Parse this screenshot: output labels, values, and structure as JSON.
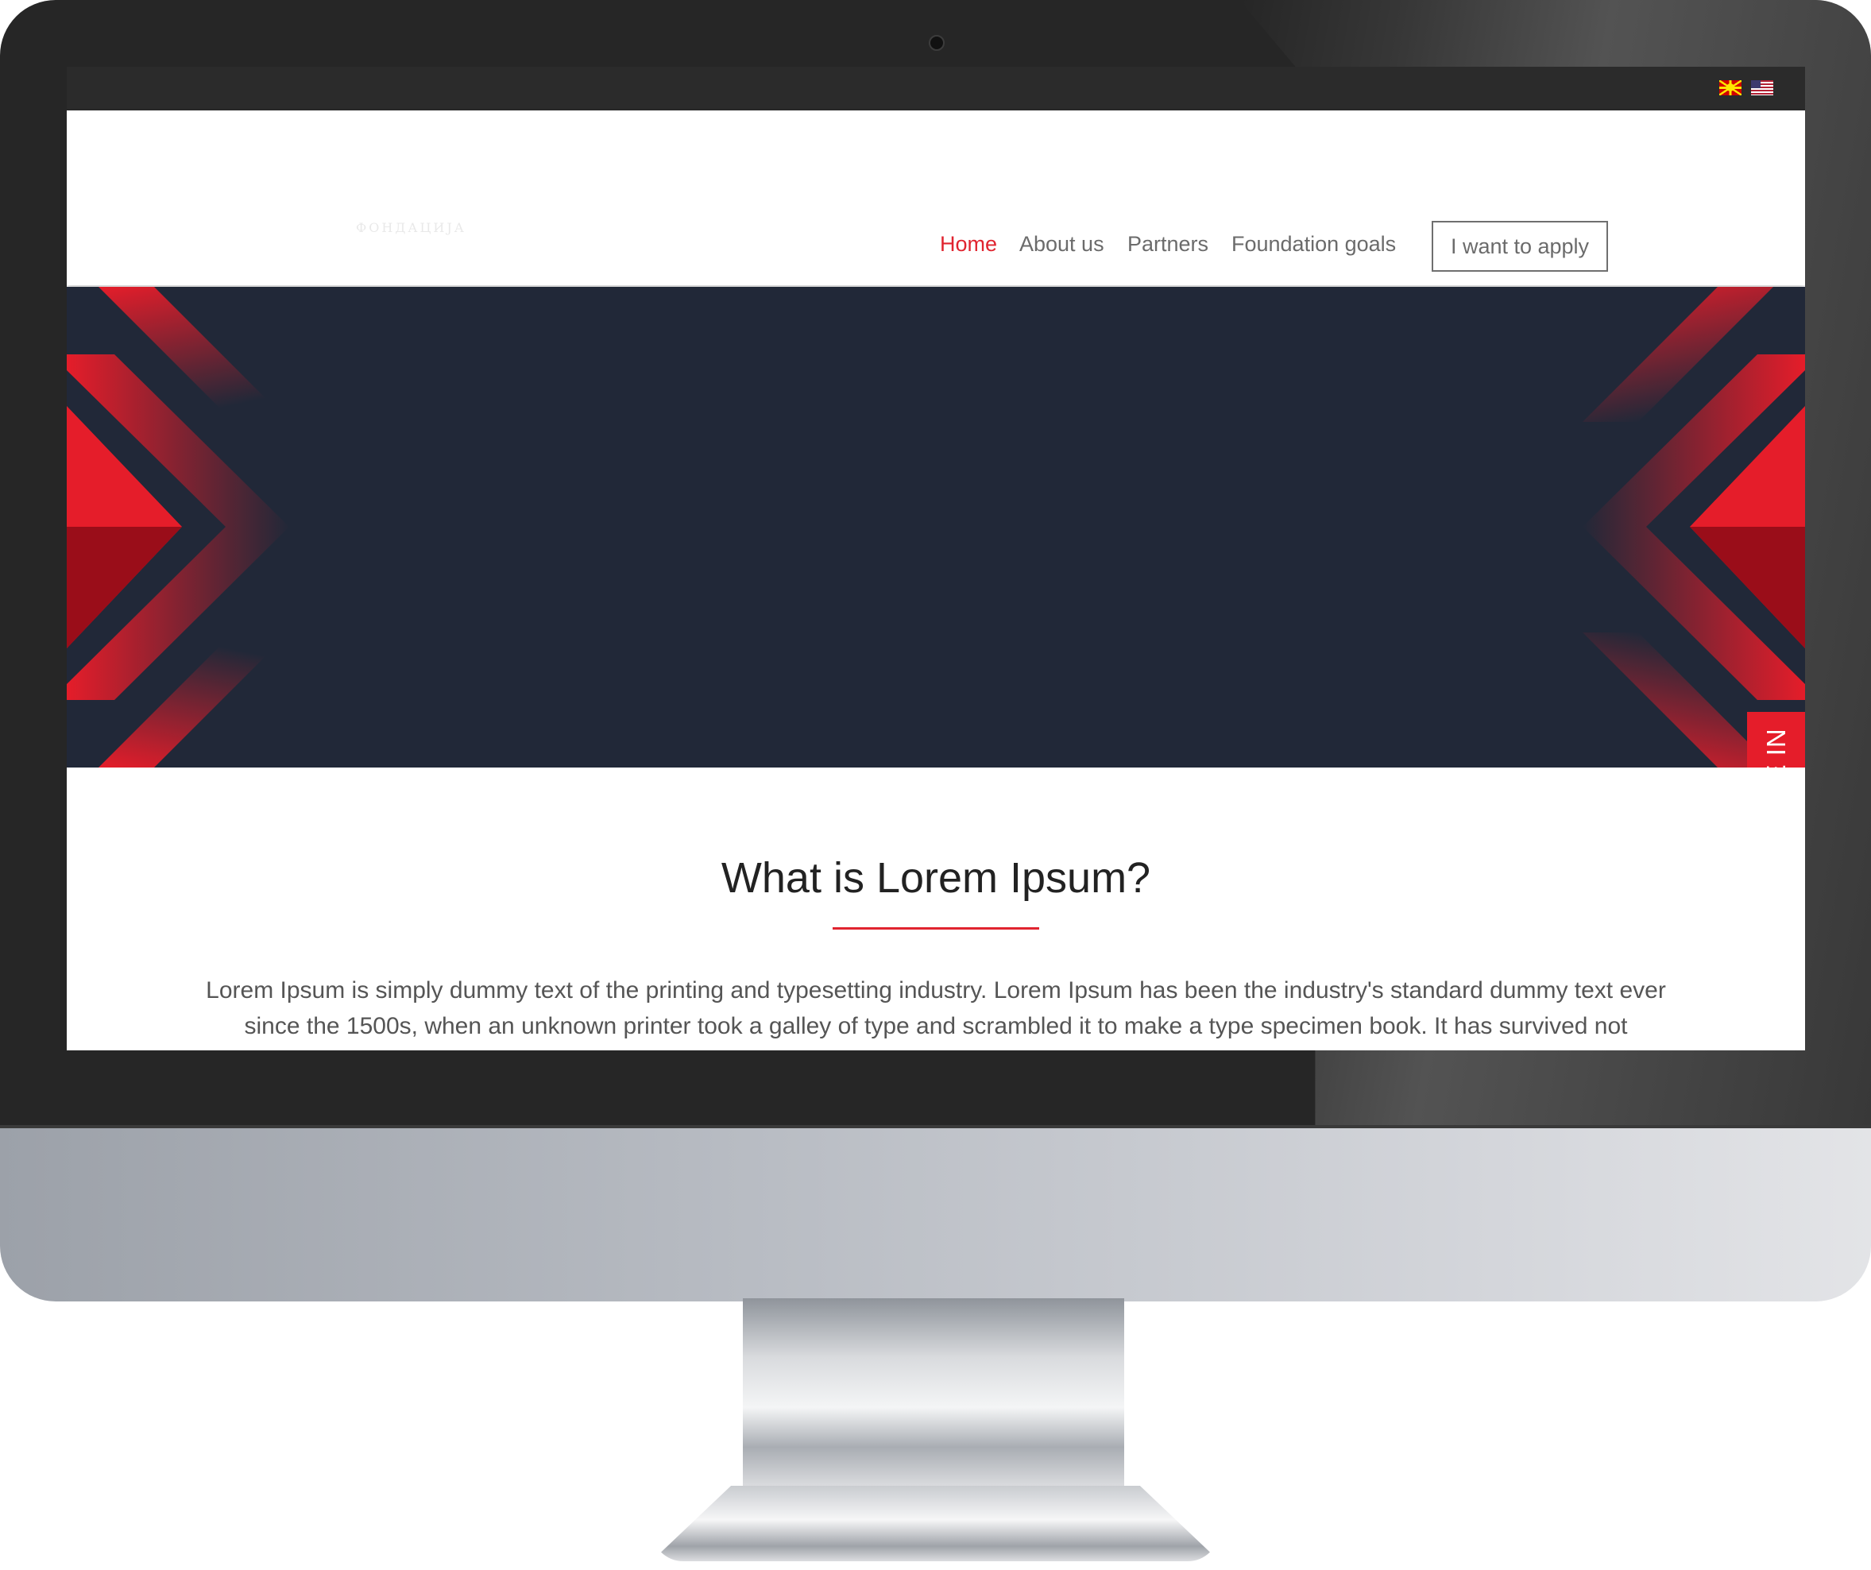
{
  "topbar": {
    "languages": [
      {
        "name": "mk-flag-icon",
        "label": "Macedonian"
      },
      {
        "name": "us-flag-icon",
        "label": "English"
      }
    ]
  },
  "header": {
    "logo_text": "ФОНДАЦИЈА",
    "nav": [
      {
        "label": "Home",
        "active": true
      },
      {
        "label": "About us",
        "active": false
      },
      {
        "label": "Partners",
        "active": false
      },
      {
        "label": "Foundation goals",
        "active": false
      }
    ],
    "apply_label": "I want to apply"
  },
  "hero": {
    "signin_label": "SIGN ME IN"
  },
  "content": {
    "heading": "What is Lorem Ipsum?",
    "paragraph": "Lorem Ipsum is simply dummy text of the printing and typesetting industry. Lorem Ipsum has been the industry's standard dummy text ever since the 1500s, when an unknown printer took a galley of type and scrambled it to make a type specimen book. It has survived not"
  },
  "colors": {
    "accent": "#e0242f",
    "hero_bg": "#212838",
    "topbar_bg": "#2b2b2b"
  }
}
